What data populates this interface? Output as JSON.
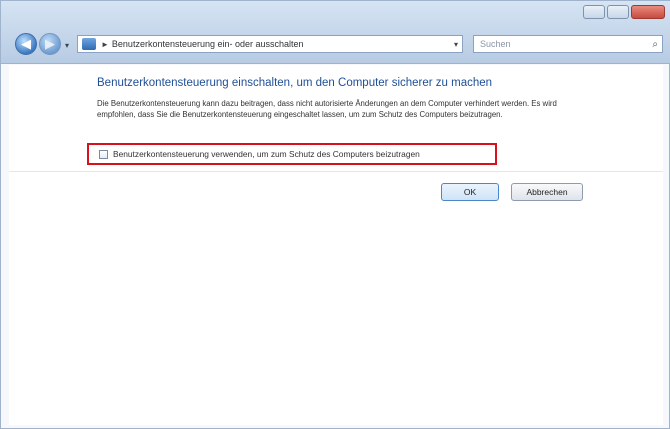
{
  "window": {
    "address_path": "Benutzerkontensteuerung ein- oder ausschalten",
    "address_separator": "►",
    "search_placeholder": "Suchen",
    "refresh_glyph": "↻",
    "search_glyph": "⌕"
  },
  "nav": {
    "back_glyph": "◀",
    "forward_glyph": "▶",
    "history_glyph": "▾"
  },
  "main": {
    "heading": "Benutzerkontensteuerung einschalten, um den Computer sicherer zu machen",
    "description": "Die Benutzerkontensteuerung kann dazu beitragen, dass nicht autorisierte Änderungen an dem Computer verhindert werden. Es wird empfohlen, dass Sie die Benutzerkontensteuerung eingeschaltet lassen, um zum Schutz des Computers beizutragen.",
    "checkbox_label": "Benutzerkontensteuerung verwenden, um zum Schutz des Computers beizutragen",
    "checkbox_checked": false
  },
  "buttons": {
    "ok_label": "OK",
    "cancel_label": "Abbrechen"
  },
  "colors": {
    "heading": "#1f4f97",
    "highlight_border": "#d8101c"
  }
}
